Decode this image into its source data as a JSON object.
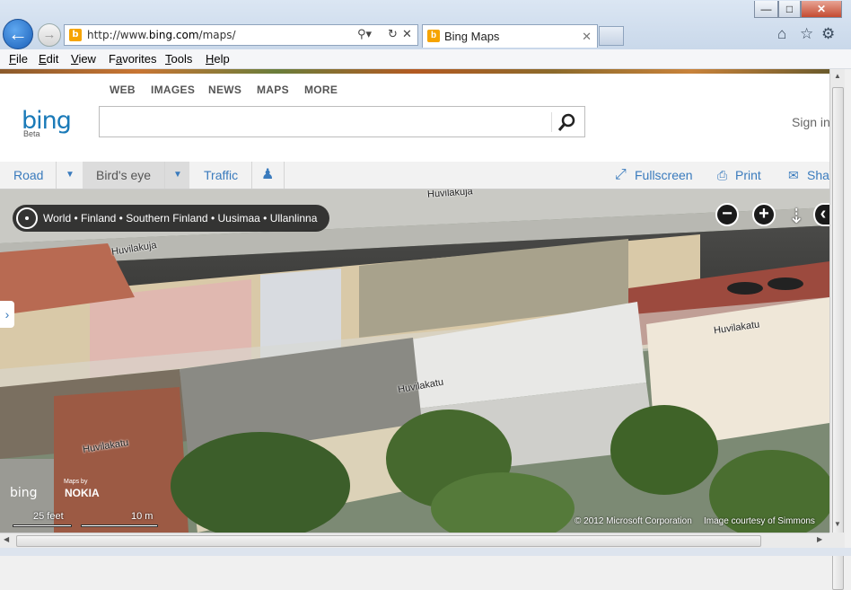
{
  "browser": {
    "url": "http://www.bing.com/maps/",
    "url_domain": "bing.com",
    "tab_title": "Bing Maps",
    "menu": [
      "File",
      "Edit",
      "View",
      "Favorites",
      "Tools",
      "Help"
    ],
    "menu_underline": [
      "F",
      "E",
      "V",
      "a",
      "T",
      "H"
    ]
  },
  "bing": {
    "nav": [
      "WEB",
      "IMAGES",
      "NEWS",
      "MAPS",
      "MORE"
    ],
    "logo": "bing",
    "beta": "Beta",
    "search_value": "",
    "sign_in": "Sign in"
  },
  "map_toolbar": {
    "road": "Road",
    "birds_eye": "Bird's eye",
    "traffic": "Traffic",
    "fullscreen": "Fullscreen",
    "print": "Print",
    "share": "Sha"
  },
  "map": {
    "breadcrumb": "World • Finland • Southern Finland • Uusimaa • Ullanlinna",
    "street_labels": [
      "Huvilakuja",
      "Huvilakuja",
      "Huvilakatu",
      "Huvilakatu",
      "Huvilakatu"
    ],
    "brand": "bing",
    "brand_partner": "NOKIA",
    "maps_by": "Maps by",
    "scale_feet": "25 feet",
    "scale_m": "10 m",
    "copyright": "© 2012 Microsoft Corporation",
    "image_credit": "Image courtesy of Simmons"
  },
  "colors": {
    "accent": "#3a7bbd",
    "bing_blue": "#1a7ab8"
  }
}
